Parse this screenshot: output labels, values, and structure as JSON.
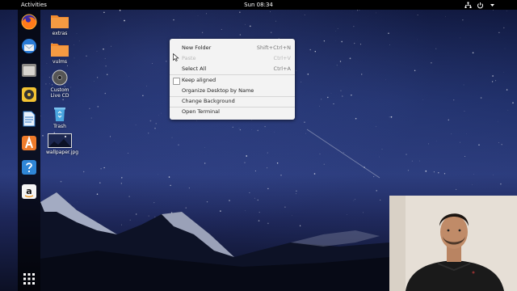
{
  "topbar": {
    "activities_label": "Activities",
    "clock_text": "Sun 08:34"
  },
  "dock": {
    "items": [
      {
        "name": "firefox",
        "icon": "firefox-icon"
      },
      {
        "name": "thunderbird",
        "icon": "thunderbird-mail-icon"
      },
      {
        "name": "files",
        "icon": "files-icon"
      },
      {
        "name": "rhythmbox",
        "icon": "rhythmbox-icon"
      },
      {
        "name": "libreoffice-writer",
        "icon": "document-icon"
      },
      {
        "name": "software",
        "icon": "software-center-icon"
      },
      {
        "name": "help",
        "icon": "help-icon"
      },
      {
        "name": "amazon",
        "icon": "amazon-icon"
      },
      {
        "name": "show-applications",
        "icon": "app-grid-icon"
      }
    ]
  },
  "desktop_icons": [
    {
      "label": "extras",
      "type": "folder"
    },
    {
      "label": "vulms",
      "type": "folder"
    },
    {
      "label": "Custom Live CD",
      "type": "disc"
    },
    {
      "label": "Trash",
      "type": "trash"
    },
    {
      "label": "wallpaper.jpg",
      "type": "image"
    }
  ],
  "context_menu": {
    "new_folder": {
      "label": "New Folder",
      "shortcut": "Shift+Ctrl+N"
    },
    "paste": {
      "label": "Paste",
      "shortcut": "Ctrl+V",
      "disabled": true
    },
    "select_all": {
      "label": "Select All",
      "shortcut": "Ctrl+A"
    },
    "keep_aligned": {
      "label": "Keep aligned",
      "checked": false
    },
    "organize": {
      "label": "Organize Desktop by Name"
    },
    "change_background": {
      "label": "Change Background"
    },
    "open_terminal": {
      "label": "Open Terminal"
    }
  },
  "colors": {
    "topbar": "#000000",
    "folder_orange": "#f28a2e",
    "menu_bg": "#f3f3f3"
  }
}
